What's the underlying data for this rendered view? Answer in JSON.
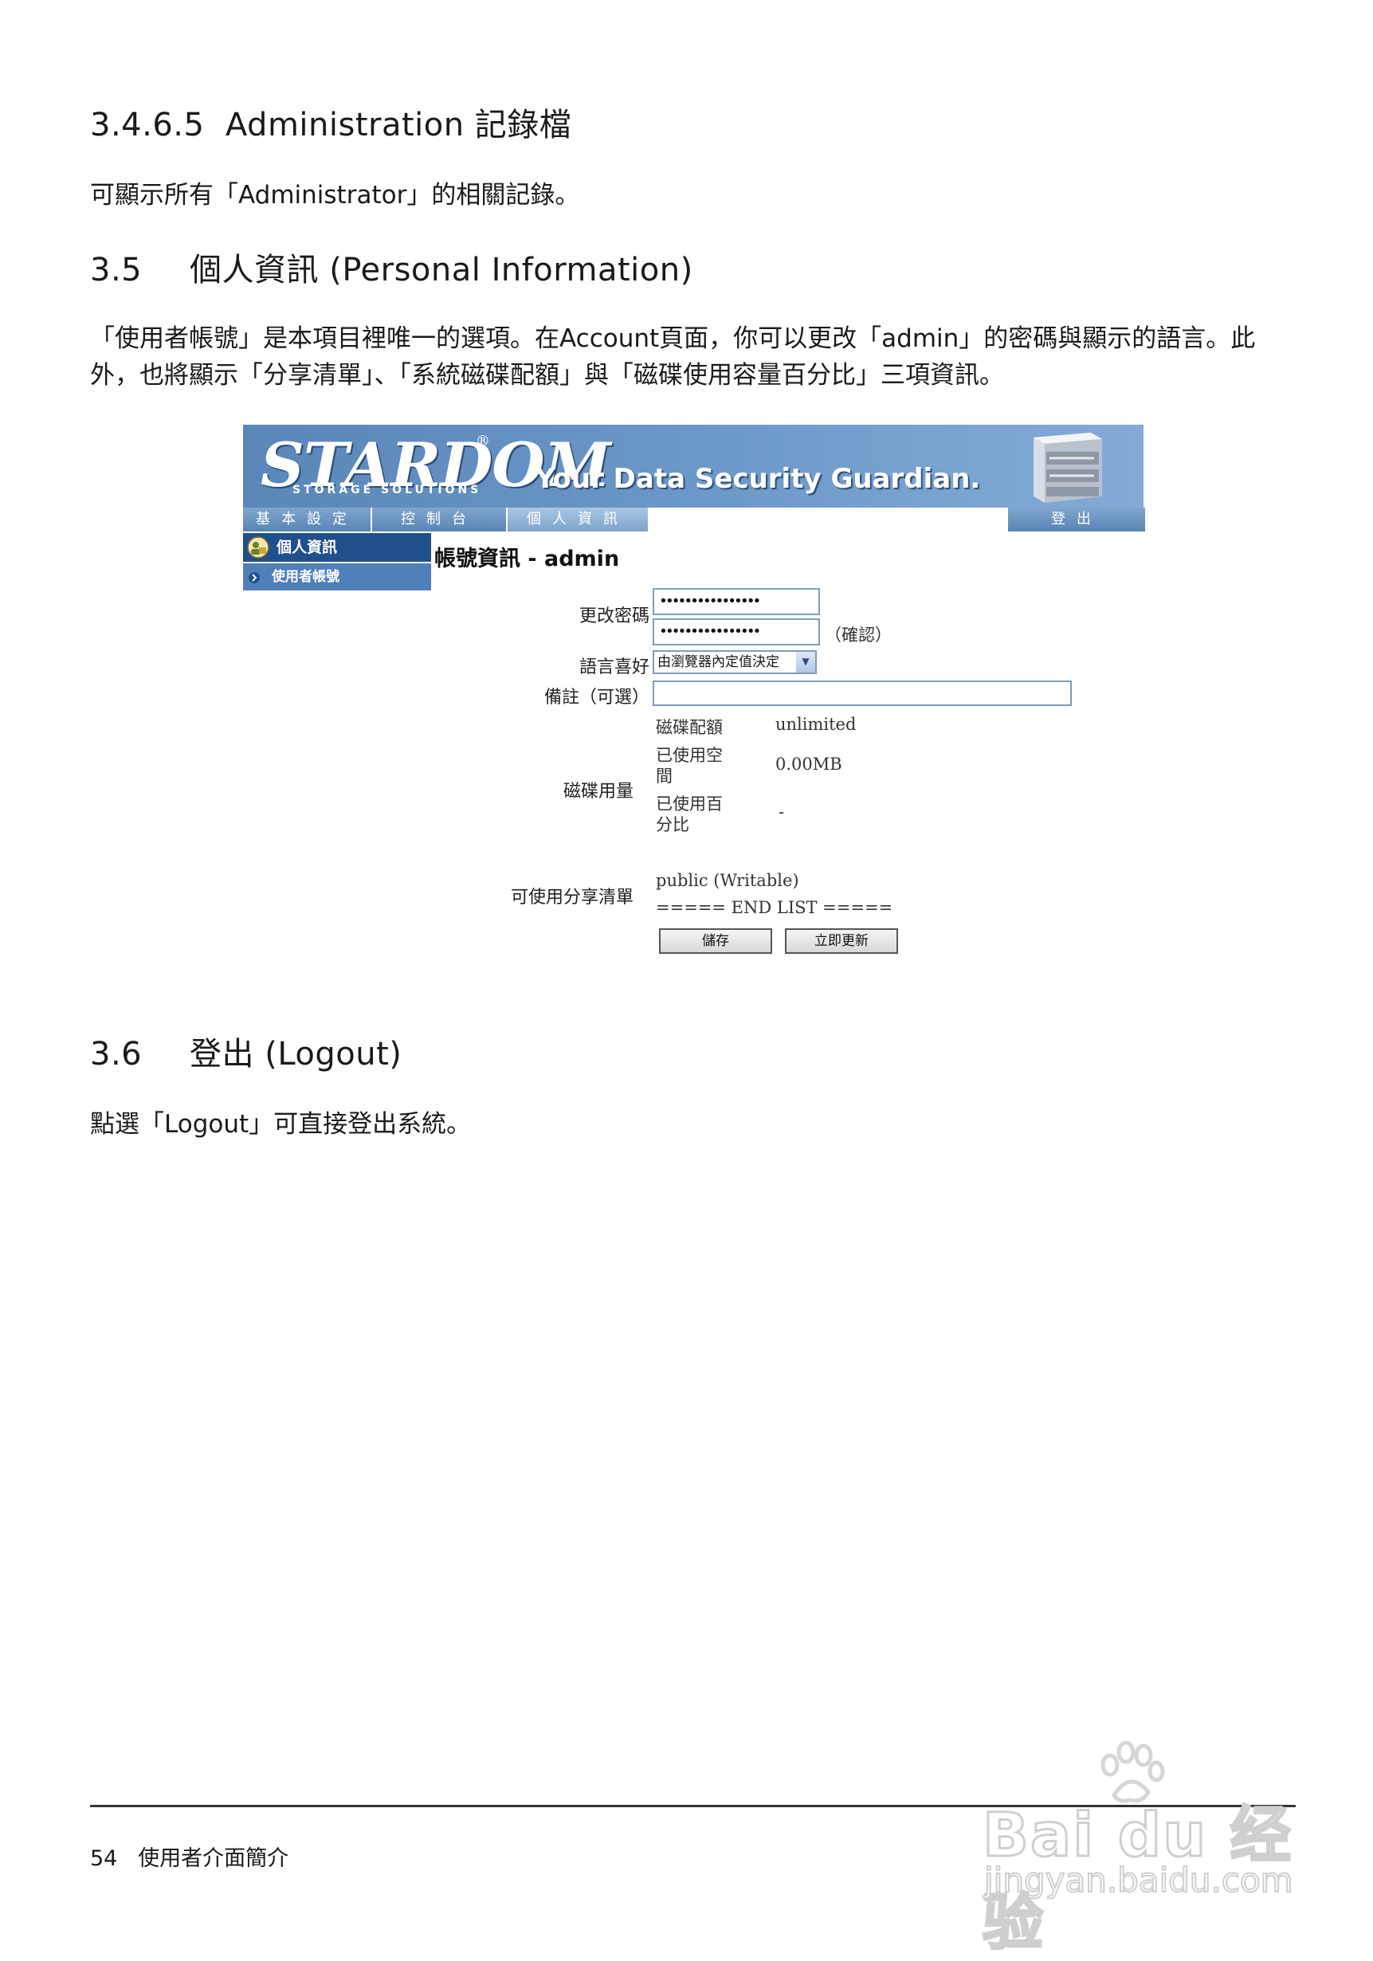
{
  "sections": {
    "s1_num": "3.4.6.5",
    "s1_title": "Administration  記錄檔",
    "s1_body": "可顯示所有「Administrator」的相關記錄。",
    "s2_num": "3.5",
    "s2_title": "個人資訊 (Personal Information)",
    "s2_body_line1": "「使用者帳號」是本項目裡唯一的選項。在Account頁面，你可以更改「admin」的密碼與顯示的語言。此",
    "s2_body_line2": "外，也將顯示「分享清單」、「系統磁碟配額」與「磁碟使用容量百分比」三項資訊。",
    "s3_num": "3.6",
    "s3_title": "登出 (Logout)",
    "s3_body": "點選「Logout」可直接登出系統。"
  },
  "screenshot": {
    "logo": "STARDOM",
    "logo_reg": "®",
    "logo_sub": "STORAGE SOLUTIONS",
    "tagline": "Your Data Security Guardian.",
    "tabs": [
      "基本設定",
      "控制台",
      "個人資訊"
    ],
    "logout_tab": "登出",
    "sidebar_section": "個人資訊",
    "sidebar_item": "使用者帳號",
    "account_title": "帳號資訊 - admin",
    "change_password_label": "更改密碼",
    "password_value": "••••••••••••••••",
    "confirm_label": "（確認）",
    "language_label": "語言喜好",
    "language_value": "由瀏覽器內定值決定",
    "note_label": "備註（可選）",
    "note_value": "",
    "disk_usage_label": "磁碟用量",
    "quota_label": "磁碟配額",
    "quota_value": "unlimited",
    "used_space_label_1": "已使用空",
    "used_space_label_2": "間",
    "used_space_value": "0.00MB",
    "used_pct_label_1": "已使用百",
    "used_pct_label_2": "分比",
    "used_pct_value": "-",
    "shares_label": "可使用分享清單",
    "share_1": "public (Writable)",
    "share_end": "===== END LIST =====",
    "save_button": "儲存",
    "update_button": "立即更新"
  },
  "footer": {
    "page_number": "54",
    "chapter": "使用者介面簡介"
  },
  "watermark": {
    "brand": "Bai du 经验",
    "url": "jingyan.baidu.com"
  }
}
